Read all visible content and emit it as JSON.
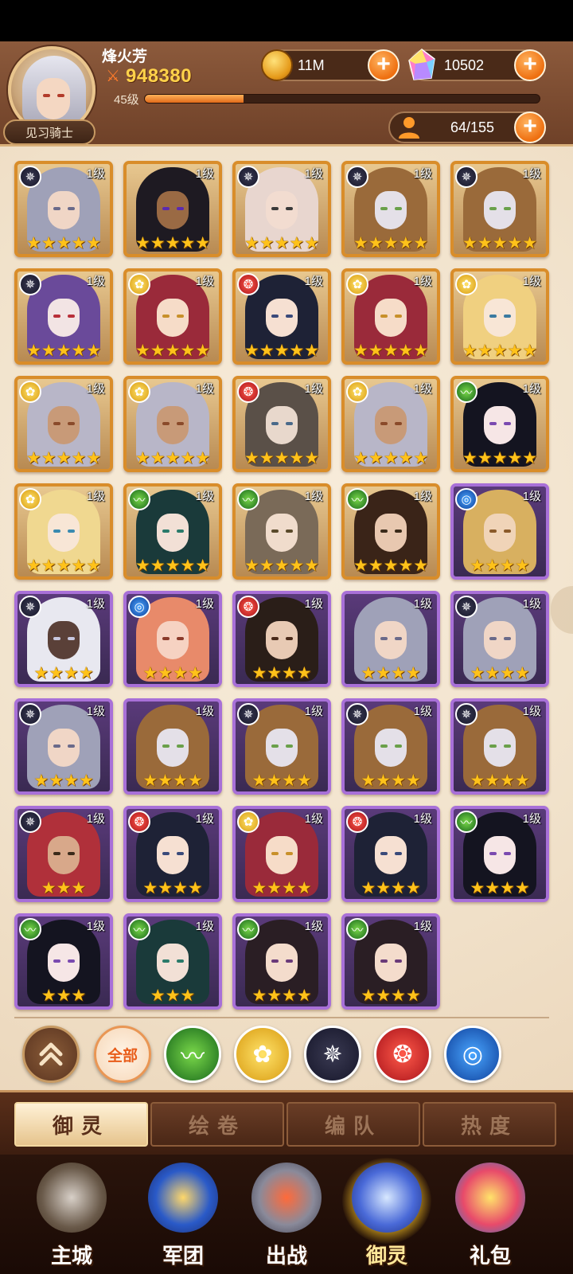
{
  "header": {
    "player_name": "烽火芳",
    "power": "948380",
    "level_label": "45级",
    "exp_progress": 0.25,
    "rank_title": "见习骑士",
    "coins": "11M",
    "gems": "10502",
    "hero_capacity": "64/155"
  },
  "cards": [
    {
      "level": "1级",
      "element": "dark",
      "stars": 5,
      "frame": "gold",
      "hair": "#9fa1b8",
      "skin": "#f0d6c6",
      "eye": "#6a6a8a"
    },
    {
      "level": "1级",
      "element": "none",
      "stars": 5,
      "frame": "gold",
      "hair": "#1e1a22",
      "skin": "#9a6a44",
      "eye": "#5a2ab0"
    },
    {
      "level": "1级",
      "element": "dark",
      "stars": 5,
      "frame": "gold",
      "hair": "#e8d6cf",
      "skin": "#f2dcd0",
      "eye": "#3a3a3a"
    },
    {
      "level": "1级",
      "element": "dark",
      "stars": 5,
      "frame": "gold",
      "hair": "#9a6a3a",
      "skin": "#e4e0e8",
      "eye": "#6aa04a"
    },
    {
      "level": "1级",
      "element": "dark",
      "stars": 5,
      "frame": "gold",
      "hair": "#9a6a3a",
      "skin": "#e4e0e8",
      "eye": "#6aa04a"
    },
    {
      "level": "1级",
      "element": "dark",
      "stars": 5,
      "frame": "gold",
      "hair": "#6a4a9a",
      "skin": "#f2e4e4",
      "eye": "#b8303a"
    },
    {
      "level": "1级",
      "element": "light",
      "stars": 5,
      "frame": "gold",
      "hair": "#9a2a3a",
      "skin": "#f6dcc8",
      "eye": "#c8902a"
    },
    {
      "level": "1级",
      "element": "fire",
      "stars": 5,
      "frame": "gold",
      "hair": "#1e2236",
      "skin": "#f6e0d2",
      "eye": "#3a4a7a"
    },
    {
      "level": "1级",
      "element": "light",
      "stars": 5,
      "frame": "gold",
      "hair": "#9a2a3a",
      "skin": "#f6dcc8",
      "eye": "#c8902a"
    },
    {
      "level": "1级",
      "element": "light",
      "stars": 5,
      "frame": "gold",
      "hair": "#f0d080",
      "skin": "#f8e6d6",
      "eye": "#3a7aa0"
    },
    {
      "level": "1级",
      "element": "light",
      "stars": 5,
      "frame": "gold",
      "hair": "#b8b6c8",
      "skin": "#c89a78",
      "eye": "#8a4a2a"
    },
    {
      "level": "1级",
      "element": "light",
      "stars": 5,
      "frame": "gold",
      "hair": "#b8b6c8",
      "skin": "#c89a78",
      "eye": "#8a4a2a"
    },
    {
      "level": "1级",
      "element": "fire",
      "stars": 5,
      "frame": "gold",
      "hair": "#5a5048",
      "skin": "#e8d8cc",
      "eye": "#4a6a8a"
    },
    {
      "level": "1级",
      "element": "light",
      "stars": 5,
      "frame": "gold",
      "hair": "#b8b6c8",
      "skin": "#c89a78",
      "eye": "#8a4a2a"
    },
    {
      "level": "1级",
      "element": "wind",
      "stars": 5,
      "frame": "gold",
      "hair": "#141420",
      "skin": "#f6e6e6",
      "eye": "#7a4ab0"
    },
    {
      "level": "1级",
      "element": "light",
      "stars": 5,
      "frame": "gold",
      "hair": "#f0d890",
      "skin": "#f8e6d6",
      "eye": "#3a8ab0"
    },
    {
      "level": "1级",
      "element": "wind",
      "stars": 5,
      "frame": "gold",
      "hair": "#1a3a3a",
      "skin": "#f2e0d6",
      "eye": "#2a7a6a"
    },
    {
      "level": "1级",
      "element": "wind",
      "stars": 5,
      "frame": "gold",
      "hair": "#7a6a58",
      "skin": "#f0dccc",
      "eye": "#5a4a2a"
    },
    {
      "level": "1级",
      "element": "wind",
      "stars": 5,
      "frame": "gold",
      "hair": "#3a2418",
      "skin": "#e8c8b0",
      "eye": "#3a2a1a"
    },
    {
      "level": "1级",
      "element": "water",
      "stars": 4,
      "frame": "purple",
      "hair": "#d8b060",
      "skin": "#f0d4b8",
      "eye": "#8a5a2a"
    },
    {
      "level": "1级",
      "element": "dark",
      "stars": 4,
      "frame": "purple",
      "hair": "#e8e8f0",
      "skin": "#5a4038",
      "eye": "#c8c8e0"
    },
    {
      "level": "1级",
      "element": "water",
      "stars": 4,
      "frame": "purple",
      "hair": "#e88a6a",
      "skin": "#f6d2c2",
      "eye": "#8a3a2a"
    },
    {
      "level": "1级",
      "element": "fire",
      "stars": 4,
      "frame": "purple",
      "hair": "#2a1e18",
      "skin": "#e8cab4",
      "eye": "#4a2a1a"
    },
    {
      "level": "1级",
      "element": "none",
      "stars": 4,
      "frame": "purple",
      "hair": "#9fa1b8",
      "skin": "#f0d6c6",
      "eye": "#6a6a8a"
    },
    {
      "level": "1级",
      "element": "dark",
      "stars": 4,
      "frame": "purple",
      "hair": "#9fa1b8",
      "skin": "#f0d6c6",
      "eye": "#6a6a8a"
    },
    {
      "level": "1级",
      "element": "dark",
      "stars": 4,
      "frame": "purple",
      "hair": "#9fa1b8",
      "skin": "#f0d6c6",
      "eye": "#6a6a8a"
    },
    {
      "level": "1级",
      "element": "none",
      "stars": 4,
      "frame": "purple",
      "hair": "#9a6a3a",
      "skin": "#e4e0e8",
      "eye": "#6aa04a"
    },
    {
      "level": "1级",
      "element": "dark",
      "stars": 4,
      "frame": "purple",
      "hair": "#9a6a3a",
      "skin": "#e4e0e8",
      "eye": "#6aa04a"
    },
    {
      "level": "1级",
      "element": "dark",
      "stars": 4,
      "frame": "purple",
      "hair": "#9a6a3a",
      "skin": "#e4e0e8",
      "eye": "#6aa04a"
    },
    {
      "level": "1级",
      "element": "dark",
      "stars": 4,
      "frame": "purple",
      "hair": "#9a6a3a",
      "skin": "#e4e0e8",
      "eye": "#6aa04a"
    },
    {
      "level": "1级",
      "element": "dark",
      "stars": 3,
      "frame": "purple",
      "hair": "#b0303a",
      "skin": "#d8a88a",
      "eye": "#3a2a1a"
    },
    {
      "level": "1级",
      "element": "fire",
      "stars": 4,
      "frame": "purple",
      "hair": "#1e2236",
      "skin": "#f6e0d2",
      "eye": "#3a4a7a"
    },
    {
      "level": "1级",
      "element": "light",
      "stars": 4,
      "frame": "purple",
      "hair": "#9a2a3a",
      "skin": "#f6dcc8",
      "eye": "#c8902a"
    },
    {
      "level": "1级",
      "element": "fire",
      "stars": 4,
      "frame": "purple",
      "hair": "#1e2236",
      "skin": "#f6e0d2",
      "eye": "#3a4a7a"
    },
    {
      "level": "1级",
      "element": "wind",
      "stars": 4,
      "frame": "purple",
      "hair": "#141420",
      "skin": "#f6e6e6",
      "eye": "#7a4ab0"
    },
    {
      "level": "1级",
      "element": "wind",
      "stars": 3,
      "frame": "purple",
      "hair": "#141420",
      "skin": "#f6e6e6",
      "eye": "#7a4ab0"
    },
    {
      "level": "1级",
      "element": "wind",
      "stars": 3,
      "frame": "purple",
      "hair": "#1a3a3a",
      "skin": "#f2e0d6",
      "eye": "#2a7a6a"
    },
    {
      "level": "1级",
      "element": "wind",
      "stars": 4,
      "frame": "purple",
      "hair": "#2a1e24",
      "skin": "#f4dccc",
      "eye": "#6a3a7a"
    },
    {
      "level": "1级",
      "element": "wind",
      "stars": 4,
      "frame": "purple",
      "hair": "#2a1e24",
      "skin": "#f4dccc",
      "eye": "#6a3a7a"
    }
  ],
  "filters": [
    {
      "icon": "collapse-up-icon",
      "label": ""
    },
    {
      "icon": "all-filter",
      "label": "全部"
    },
    {
      "icon": "wind-element-icon",
      "label": ""
    },
    {
      "icon": "light-element-icon",
      "label": ""
    },
    {
      "icon": "dark-element-icon",
      "label": ""
    },
    {
      "icon": "fire-element-icon",
      "label": ""
    },
    {
      "icon": "water-element-icon",
      "label": ""
    }
  ],
  "tabs": [
    "御灵",
    "绘卷",
    "编队",
    "热度"
  ],
  "nav": [
    "主城",
    "军团",
    "出战",
    "御灵",
    "礼包"
  ],
  "colors": {
    "gold_frame": "#d98d2a",
    "purple_frame": "#a870d8",
    "star": "#ffc21a",
    "accent_orange": "#ee6f10"
  }
}
